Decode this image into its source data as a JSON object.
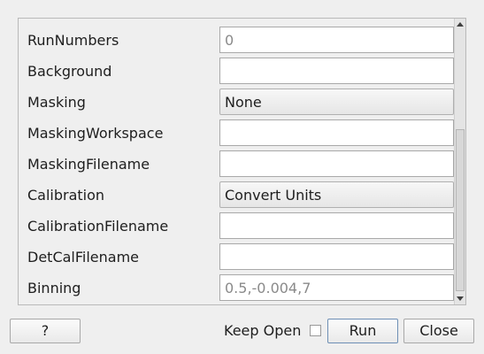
{
  "properties": [
    {
      "label": "RunNumbers",
      "kind": "text",
      "value": "0",
      "placeholder": true
    },
    {
      "label": "Background",
      "kind": "text",
      "value": "",
      "placeholder": false
    },
    {
      "label": "Masking",
      "kind": "combo",
      "value": "None"
    },
    {
      "label": "MaskingWorkspace",
      "kind": "text",
      "value": "",
      "placeholder": false
    },
    {
      "label": "MaskingFilename",
      "kind": "text",
      "value": "",
      "placeholder": false
    },
    {
      "label": "Calibration",
      "kind": "combo",
      "value": "Convert Units"
    },
    {
      "label": "CalibrationFilename",
      "kind": "text",
      "value": "",
      "placeholder": false
    },
    {
      "label": "DetCalFilename",
      "kind": "text",
      "value": "",
      "placeholder": false
    },
    {
      "label": "Binning",
      "kind": "text",
      "value": "0.5,-0.004,7",
      "placeholder": true
    }
  ],
  "footer": {
    "help_label": "?",
    "keep_open_label": "Keep Open",
    "keep_open_checked": false,
    "run_label": "Run",
    "close_label": "Close"
  },
  "scrollbar": {
    "position_fraction": 1.0
  }
}
